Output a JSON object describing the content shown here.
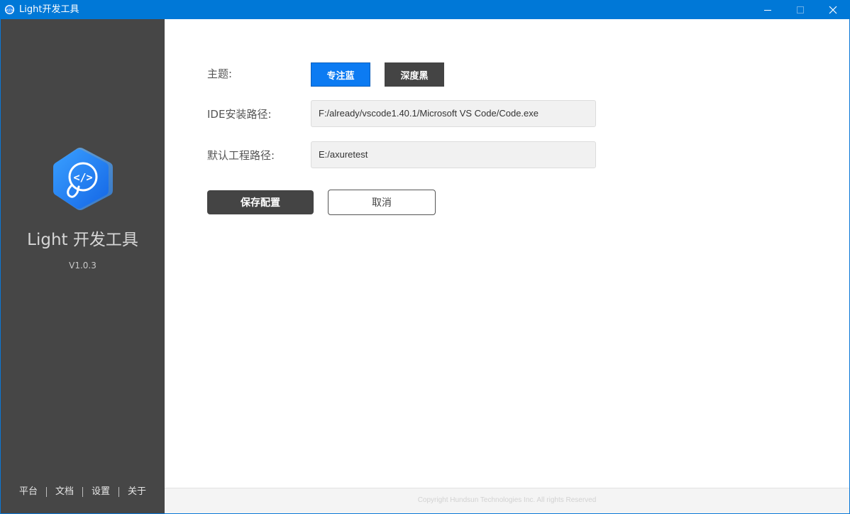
{
  "window": {
    "title": "Light开发工具",
    "icon": "app-logo-icon"
  },
  "sidebar": {
    "app_name": "Light 开发工具",
    "version": "V1.0.3",
    "nav": [
      {
        "label": "平台"
      },
      {
        "label": "文档"
      },
      {
        "label": "设置"
      },
      {
        "label": "关于"
      }
    ]
  },
  "settings": {
    "theme_label": "主题:",
    "themes": [
      {
        "label": "专注蓝",
        "color": "#0c7bf2",
        "selected": true
      },
      {
        "label": "深度黑",
        "color": "#444444",
        "selected": false
      }
    ],
    "ide_path_label": "IDE安装路径:",
    "ide_path_value": "F:/already/vscode1.40.1/Microsoft VS Code/Code.exe",
    "project_path_label": "默认工程路径:",
    "project_path_value": "E:/axuretest",
    "save_label": "保存配置",
    "cancel_label": "取消"
  },
  "footer": {
    "copyright": "Copyright Hundsun Technologies Inc. All rights Reserved"
  },
  "colors": {
    "titlebar": "#0078d7",
    "sidebar": "#464646",
    "accent": "#0c7bf2"
  }
}
